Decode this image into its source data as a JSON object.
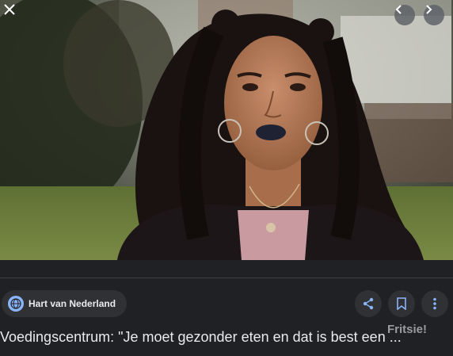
{
  "image": {
    "alt": "Young woman with curly hair and dark lipstick speaking to camera outdoors"
  },
  "controls": {
    "close_icon": "close-icon",
    "prev_icon": "chevron-left-icon",
    "next_icon": "chevron-right-icon"
  },
  "source": {
    "name": "Hart van Nederland",
    "icon": "globe-icon"
  },
  "actions": {
    "share_icon": "share-icon",
    "save_icon": "bookmark-icon",
    "more_icon": "more-vert-icon"
  },
  "title": "Voedingscentrum: \"Je moet gezonder eten en dat is best een ...",
  "watermark": "Fritsie!",
  "colors": {
    "background": "#202124",
    "chip": "#303134",
    "text": "#e8eaed",
    "accent": "#8ab4f8"
  }
}
